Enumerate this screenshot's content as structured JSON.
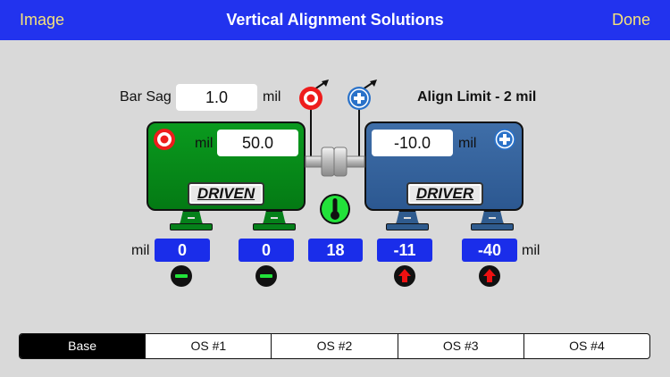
{
  "nav": {
    "left": "Image",
    "title": "Vertical Alignment Solutions",
    "right": "Done"
  },
  "bar_sag": {
    "label": "Bar Sag",
    "value": "1.0",
    "unit": "mil"
  },
  "align_limit": "Align Limit - 2 mil",
  "driven": {
    "name": "DRIVEN",
    "unit": "mil",
    "value": "50.0"
  },
  "driver": {
    "name": "DRIVER",
    "unit": "mil",
    "value": "-10.0"
  },
  "readings": {
    "unit_left": "mil",
    "unit_right": "mil",
    "values": [
      "0",
      "0",
      "18",
      "-11",
      "-40"
    ]
  },
  "indicators": [
    "level",
    "level",
    "thermometer",
    "raise",
    "raise"
  ],
  "colors": {
    "nav_bg": "#2233ee",
    "nav_link": "#f5e27a",
    "driven_motor": "#0a9a1e",
    "driver_motor": "#3f6ea8",
    "reading_box": "#1a2dea",
    "ok_green": "#22e23a",
    "warn_red": "#ee1111"
  },
  "tabs": {
    "active": "Base",
    "items": [
      "Base",
      "OS #1",
      "OS #2",
      "OS #3",
      "OS #4"
    ]
  }
}
